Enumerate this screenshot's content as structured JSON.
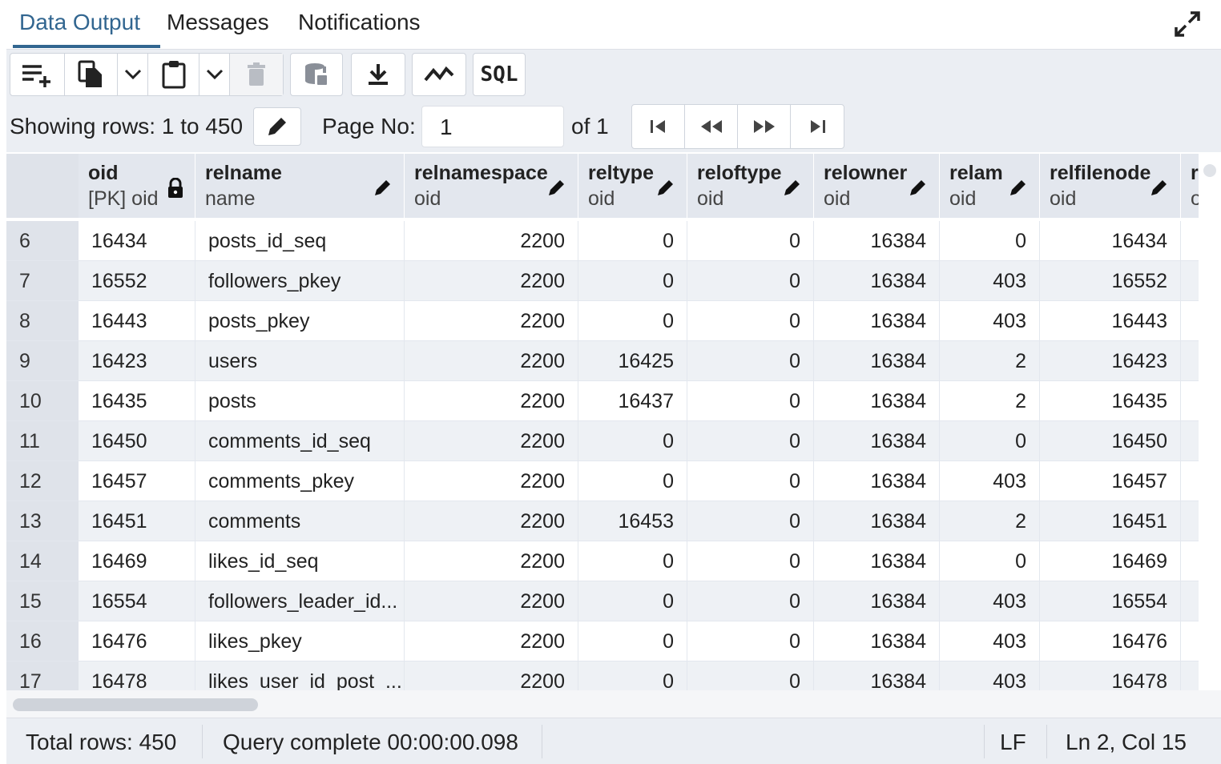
{
  "tabs": [
    {
      "label": "Data Output",
      "active": true
    },
    {
      "label": "Messages",
      "active": false
    },
    {
      "label": "Notifications",
      "active": false
    }
  ],
  "toolbar": {
    "sql_label": "SQL",
    "icons": [
      "add-row-icon",
      "copy-icon",
      "chevron-down-icon",
      "paste-icon",
      "chevron-down-icon",
      "delete-icon",
      "save-data-icon",
      "download-icon",
      "graph-visualiser-icon",
      "sql-icon"
    ]
  },
  "pagination": {
    "showing_label": "Showing rows: 1 to 450",
    "page_label": "Page No:",
    "page_value": "1",
    "of_label": "of 1"
  },
  "columns": [
    {
      "name": "oid",
      "type": "[PK] oid",
      "locked": true
    },
    {
      "name": "relname",
      "type": "name",
      "locked": false
    },
    {
      "name": "relnamespace",
      "type": "oid",
      "locked": false
    },
    {
      "name": "reltype",
      "type": "oid",
      "locked": false
    },
    {
      "name": "reloftype",
      "type": "oid",
      "locked": false
    },
    {
      "name": "relowner",
      "type": "oid",
      "locked": false
    },
    {
      "name": "relam",
      "type": "oid",
      "locked": false
    },
    {
      "name": "relfilenode",
      "type": "oid",
      "locked": false
    },
    {
      "name": "r",
      "type": "o",
      "locked": false
    }
  ],
  "rows": [
    {
      "n": "6",
      "c": [
        "16434",
        "posts_id_seq",
        "2200",
        "0",
        "0",
        "16384",
        "0",
        "16434"
      ]
    },
    {
      "n": "7",
      "c": [
        "16552",
        "followers_pkey",
        "2200",
        "0",
        "0",
        "16384",
        "403",
        "16552"
      ]
    },
    {
      "n": "8",
      "c": [
        "16443",
        "posts_pkey",
        "2200",
        "0",
        "0",
        "16384",
        "403",
        "16443"
      ]
    },
    {
      "n": "9",
      "c": [
        "16423",
        "users",
        "2200",
        "16425",
        "0",
        "16384",
        "2",
        "16423"
      ]
    },
    {
      "n": "10",
      "c": [
        "16435",
        "posts",
        "2200",
        "16437",
        "0",
        "16384",
        "2",
        "16435"
      ]
    },
    {
      "n": "11",
      "c": [
        "16450",
        "comments_id_seq",
        "2200",
        "0",
        "0",
        "16384",
        "0",
        "16450"
      ]
    },
    {
      "n": "12",
      "c": [
        "16457",
        "comments_pkey",
        "2200",
        "0",
        "0",
        "16384",
        "403",
        "16457"
      ]
    },
    {
      "n": "13",
      "c": [
        "16451",
        "comments",
        "2200",
        "16453",
        "0",
        "16384",
        "2",
        "16451"
      ]
    },
    {
      "n": "14",
      "c": [
        "16469",
        "likes_id_seq",
        "2200",
        "0",
        "0",
        "16384",
        "0",
        "16469"
      ]
    },
    {
      "n": "15",
      "c": [
        "16554",
        "followers_leader_id...",
        "2200",
        "0",
        "0",
        "16384",
        "403",
        "16554"
      ]
    },
    {
      "n": "16",
      "c": [
        "16476",
        "likes_pkey",
        "2200",
        "0",
        "0",
        "16384",
        "403",
        "16476"
      ]
    },
    {
      "n": "17",
      "c": [
        "16478",
        "likes_user_id_post_...",
        "2200",
        "0",
        "0",
        "16384",
        "403",
        "16478"
      ]
    }
  ],
  "status": {
    "total_rows": "Total rows: 450",
    "query": "Query complete 00:00:00.098",
    "eol": "LF",
    "cursor": "Ln 2, Col 15"
  },
  "colors": {
    "accent": "#326690",
    "header_bg": "#e3e7ee",
    "toolbar_bg": "#ebeef3"
  }
}
